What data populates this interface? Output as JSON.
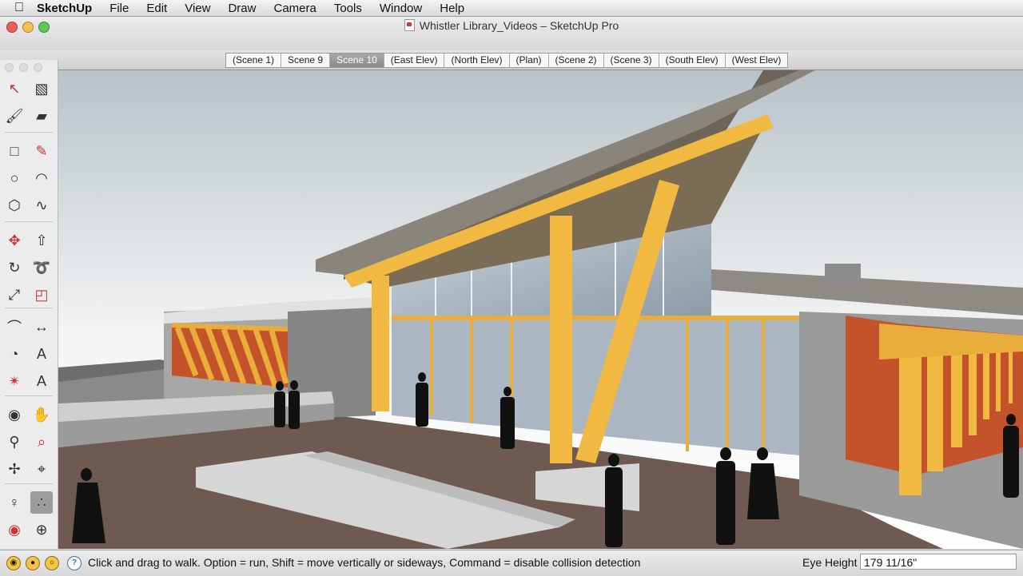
{
  "menubar": {
    "apple_icon": "apple-logo-icon",
    "app_name": "SketchUp",
    "items": [
      "File",
      "Edit",
      "View",
      "Draw",
      "Camera",
      "Tools",
      "Window",
      "Help"
    ]
  },
  "window": {
    "title": "Whistler Library_Videos – SketchUp Pro",
    "traffic_lights": {
      "close": "#ee5e57",
      "minimize": "#f6be4f",
      "zoom": "#62c655"
    }
  },
  "scene_tabs": {
    "items": [
      "(Scene 1)",
      "Scene 9",
      "Scene 10",
      "(East Elev)",
      "(North Elev)",
      "(Plan)",
      "(Scene 2)",
      "(Scene 3)",
      "(South Elev)",
      "(West Elev)"
    ],
    "active_index": 2
  },
  "tools": [
    {
      "name": "select",
      "icon": "arrow-select-icon",
      "selected": false
    },
    {
      "name": "make-component",
      "icon": "make-component-icon",
      "selected": false
    },
    {
      "name": "paint-bucket",
      "icon": "paint-bucket-icon",
      "selected": false
    },
    {
      "name": "eraser",
      "icon": "eraser-icon",
      "selected": false
    },
    {
      "name": "rectangle",
      "icon": "rectangle-icon",
      "selected": false
    },
    {
      "name": "line",
      "icon": "pencil-line-icon",
      "selected": false
    },
    {
      "name": "circle",
      "icon": "circle-icon",
      "selected": false
    },
    {
      "name": "arc",
      "icon": "arc-icon",
      "selected": false
    },
    {
      "name": "polygon",
      "icon": "polygon-icon",
      "selected": false
    },
    {
      "name": "freehand",
      "icon": "freehand-icon",
      "selected": false
    },
    {
      "name": "move",
      "icon": "move-icon",
      "selected": false
    },
    {
      "name": "push-pull",
      "icon": "push-pull-icon",
      "selected": false
    },
    {
      "name": "rotate",
      "icon": "rotate-icon",
      "selected": false
    },
    {
      "name": "follow-me",
      "icon": "follow-me-icon",
      "selected": false
    },
    {
      "name": "scale",
      "icon": "scale-icon",
      "selected": false
    },
    {
      "name": "offset",
      "icon": "offset-icon",
      "selected": false
    },
    {
      "name": "tape-measure",
      "icon": "tape-measure-icon",
      "selected": false
    },
    {
      "name": "dimension",
      "icon": "dimension-icon",
      "selected": false
    },
    {
      "name": "protractor",
      "icon": "protractor-icon",
      "selected": false
    },
    {
      "name": "text",
      "icon": "text-label-icon",
      "selected": false
    },
    {
      "name": "axes",
      "icon": "axes-icon",
      "selected": false
    },
    {
      "name": "3d-text",
      "icon": "3d-text-icon",
      "selected": false
    },
    {
      "name": "orbit",
      "icon": "orbit-icon",
      "selected": false
    },
    {
      "name": "pan",
      "icon": "pan-hand-icon",
      "selected": false
    },
    {
      "name": "zoom",
      "icon": "zoom-icon",
      "selected": false
    },
    {
      "name": "zoom-window",
      "icon": "zoom-window-icon",
      "selected": false
    },
    {
      "name": "zoom-extents",
      "icon": "zoom-extents-icon",
      "selected": false
    },
    {
      "name": "previous-view",
      "icon": "previous-view-icon",
      "selected": false
    },
    {
      "name": "position-camera",
      "icon": "position-camera-icon",
      "selected": false
    },
    {
      "name": "walk",
      "icon": "walk-footprints-icon",
      "selected": true
    },
    {
      "name": "look-around",
      "icon": "look-around-eye-icon",
      "selected": false
    },
    {
      "name": "section-plane",
      "icon": "section-plane-icon",
      "selected": false
    }
  ],
  "statusbar": {
    "icons": [
      "geolocation-icon",
      "credits-icon",
      "instructor-icon",
      "help-icon"
    ],
    "hint": "Click and drag to walk.  Option = run, Shift = move vertically or sideways, Command = disable collision detection",
    "vcb_label": "Eye Height",
    "vcb_value": "179 11/16\""
  },
  "colors": {
    "beam": "#f2b942",
    "roof": "#8a857b",
    "wall": "#8f8f8f",
    "floor": "#6e5a50",
    "glass": "#b9c6d1",
    "accent_wall": "#c4532c"
  }
}
